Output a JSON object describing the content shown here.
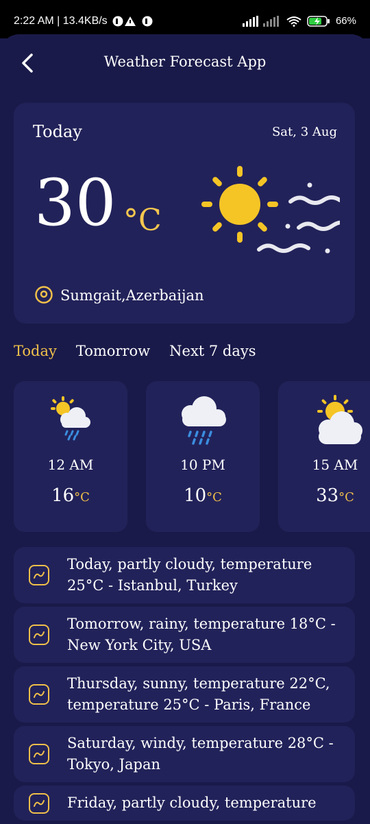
{
  "status_bar": {
    "time_info": "2:22 AM | 13.4KB/s",
    "battery": "66%"
  },
  "header": {
    "title": "Weather Forecast App"
  },
  "today_card": {
    "label": "Today",
    "date": "Sat, 3 Aug",
    "temperature": "30",
    "unit": "°C",
    "location": "Sumgait,Azerbaijan"
  },
  "tabs": [
    "Today",
    "Tomorrow",
    "Next 7 days"
  ],
  "hourly": [
    {
      "time": "12 AM",
      "temp": "16",
      "unit": "°C",
      "icon": "sun-cloud-rain-icon"
    },
    {
      "time": "10 PM",
      "temp": "10",
      "unit": "°C",
      "icon": "rain-cloud-icon"
    },
    {
      "time": "15 AM",
      "temp": "33",
      "unit": "°C",
      "icon": "sun-cloud-icon"
    }
  ],
  "forecasts": [
    "Today, partly cloudy, temperature 25°C - Istanbul, Turkey",
    "Tomorrow, rainy, temperature 18°C - New York City, USA",
    "Thursday, sunny, temperature 22°C, temperature 25°C - Paris, France",
    "Saturday, windy, temperature 28°C - Tokyo, Japan",
    "Friday, partly cloudy, temperature"
  ],
  "colors": {
    "background": "#1a1a4a",
    "card": "#22225a",
    "accent": "#f0c04a"
  }
}
